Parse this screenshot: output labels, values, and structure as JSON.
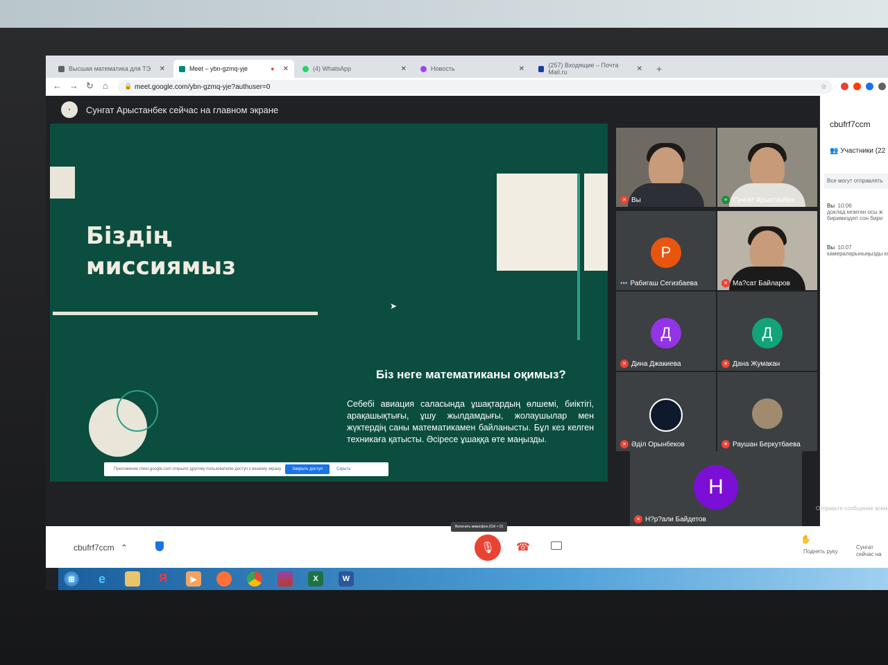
{
  "browser": {
    "tabs": [
      {
        "label": "Высшая математика для ТЭ"
      },
      {
        "label": "Meet – ybn-gzmq-yje"
      },
      {
        "label": "(4) WhatsApp"
      },
      {
        "label": "Новость"
      },
      {
        "label": "(257) Входящие – Почта Mail.ru"
      }
    ],
    "new_tab": "+",
    "url": "meet.google.com/ybn-gzmq-yje?authuser=0"
  },
  "meet": {
    "presenter_banner": "Сунгат Арыстанбек сейчас на главном экране",
    "slide": {
      "title_line1": "Біздің",
      "title_line2": "миссиямыз",
      "heading": "Біз неге математиканы оқимыз?",
      "body": "Себебі авиация саласында ұшақтардың өлшемі, биіктігі, арақашықтығы, ұшу жылдамдығы, жолаушылар мен жүктердің саны математикамен байланысты. Бұл кез келген техникаға қатысты. Әсіресе ұшаққа өте маңызды."
    },
    "share_notice": {
      "text": "Приложение meet.google.com открыло другому пользователю доступ к вашему экрану",
      "stop_button": "Закрыть доступ",
      "hide_button": "Скрыть"
    },
    "participants": [
      {
        "name": "Вы",
        "initial": "",
        "color": ""
      },
      {
        "name": "Сунгат Арыстанбек",
        "initial": "",
        "color": ""
      },
      {
        "name": "Рабигаш Сегизбаева",
        "initial": "Р",
        "color": "#e8550f"
      },
      {
        "name": "Ма?сат Байларов",
        "initial": "",
        "color": ""
      },
      {
        "name": "Дина Джакиева",
        "initial": "Д",
        "color": "#9334e6"
      },
      {
        "name": "Дана Жумакан",
        "initial": "Д",
        "color": "#12a37a"
      },
      {
        "name": "Әділ Орынбеков",
        "initial": "",
        "color": ""
      },
      {
        "name": "Раушан Беркутбаева",
        "initial": "",
        "color": ""
      },
      {
        "name": "Н?р?али Байдетов",
        "initial": "Н",
        "color": "#7b0fd6"
      }
    ],
    "chat": {
      "meeting_code": "cbufrf7ccm",
      "participants_label": "Участники (22",
      "notice": "Все могут отправлять",
      "messages": [
        {
          "author": "Вы",
          "time": "10:06",
          "line1": "доклад кезеген осы ж",
          "line2": "биримиздеп сон бири"
        },
        {
          "author": "Вы",
          "time": "10:07",
          "line1": "камераларыныңызды ко",
          "line2": ""
        }
      ],
      "input_placeholder": "Отправьте сообщение всем"
    },
    "controls": {
      "meeting_code": "cbufrf7ccm",
      "mic_tooltip": "Включить микрофон (Ctrl + D)",
      "raise_hand": "Поднять руку",
      "presenter_line1": "Сунгат",
      "presenter_line2": "сейчас на"
    }
  },
  "taskbar": {
    "icons": [
      "start",
      "ie",
      "explorer",
      "yandex",
      "media",
      "firefox",
      "chrome",
      "winrar",
      "excel",
      "word"
    ]
  },
  "colors": {
    "slide_bg": "#0b4d3f",
    "accent_teal": "#2aa089",
    "mic_red": "#ea4335"
  }
}
